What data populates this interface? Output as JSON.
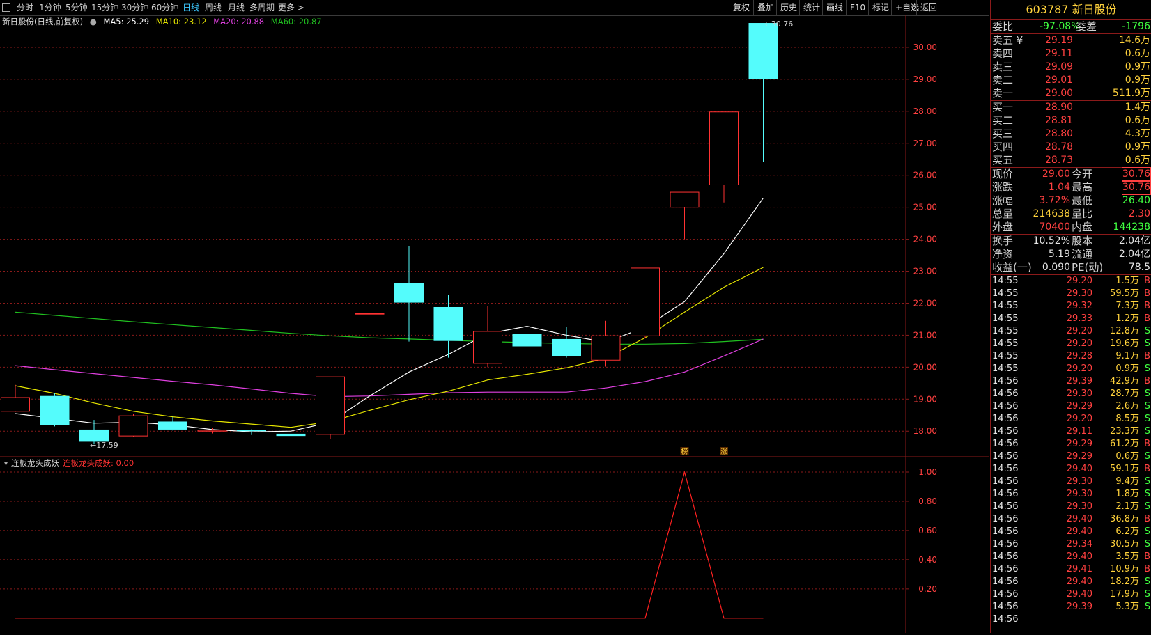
{
  "toolbar": {
    "periods": [
      "分时",
      "1分钟",
      "5分钟",
      "15分钟",
      "30分钟",
      "60分钟",
      "日线",
      "周线",
      "月线",
      "多周期",
      "更多 >"
    ],
    "active_period": "日线",
    "actions": [
      "复权",
      "叠加",
      "历史",
      "统计",
      "画线",
      "F10",
      "标记",
      "+自选",
      "返回"
    ]
  },
  "legend": {
    "name": "新日股份(日线,前复权)",
    "ma5": "MA5: 25.29",
    "ma10": "MA10: 23.12",
    "ma20": "MA20: 20.88",
    "ma60": "MA60: 20.87"
  },
  "indicator": {
    "name": "连板龙头成妖",
    "value_text": "连板龙头成妖: 0.00",
    "markers": [
      "榜",
      "涨"
    ]
  },
  "colors": {
    "up": "#ff3232",
    "down": "#54fcfc",
    "ma5": "#ffffff",
    "ma10": "#e6e600",
    "ma20": "#e040e0",
    "ma60": "#20c020",
    "grid": "#8b1a1a"
  },
  "chart_data": {
    "type": "candlestick",
    "y_axis": [
      30.0,
      29.0,
      28.0,
      27.0,
      26.0,
      25.0,
      24.0,
      23.0,
      22.0,
      21.0,
      20.0,
      19.0,
      18.0
    ],
    "ylim": [
      17.2,
      31.0
    ],
    "high_label": "30.76",
    "low_label": "17.59",
    "candles": [
      {
        "o": 18.62,
        "c": 19.05,
        "h": 19.45,
        "l": 18.6
      },
      {
        "o": 19.1,
        "c": 18.18,
        "h": 19.18,
        "l": 18.15
      },
      {
        "o": 18.05,
        "c": 17.67,
        "h": 18.35,
        "l": 17.59
      },
      {
        "o": 17.85,
        "c": 18.48,
        "h": 18.55,
        "l": 17.82
      },
      {
        "o": 18.3,
        "c": 18.05,
        "h": 18.45,
        "l": 18.02
      },
      {
        "o": 18.0,
        "c": 18.03,
        "h": 18.1,
        "l": 17.93
      },
      {
        "o": 18.04,
        "c": 18.0,
        "h": 18.06,
        "l": 17.88
      },
      {
        "o": 17.92,
        "c": 17.85,
        "h": 17.95,
        "l": 17.82
      },
      {
        "o": 17.9,
        "c": 19.7,
        "h": 19.7,
        "l": 17.75
      },
      {
        "o": 21.68,
        "c": 21.68,
        "h": 21.68,
        "l": 21.68
      },
      {
        "o": 22.63,
        "c": 22.02,
        "h": 23.78,
        "l": 20.8
      },
      {
        "o": 21.88,
        "c": 20.82,
        "h": 22.25,
        "l": 20.3
      },
      {
        "o": 20.12,
        "c": 21.12,
        "h": 21.92,
        "l": 20.0
      },
      {
        "o": 21.05,
        "c": 20.65,
        "h": 21.1,
        "l": 20.58
      },
      {
        "o": 20.88,
        "c": 20.35,
        "h": 21.25,
        "l": 20.3
      },
      {
        "o": 20.22,
        "c": 20.98,
        "h": 21.45,
        "l": 20.02
      },
      {
        "o": 20.98,
        "c": 23.1,
        "h": 23.1,
        "l": 20.9
      },
      {
        "o": 25.0,
        "c": 25.47,
        "h": 25.47,
        "l": 24.0
      },
      {
        "o": 25.7,
        "c": 27.98,
        "h": 27.98,
        "l": 25.15
      },
      {
        "o": 30.76,
        "c": 29.0,
        "h": 30.76,
        "l": 26.42
      }
    ],
    "ma5": [
      18.55,
      18.4,
      18.25,
      18.28,
      18.2,
      18.05,
      17.98,
      18.0,
      18.28,
      19.1,
      19.85,
      20.4,
      21.05,
      21.28,
      21.0,
      20.78,
      21.25,
      22.05,
      23.55,
      25.29
    ],
    "ma10": [
      19.42,
      19.18,
      18.88,
      18.62,
      18.45,
      18.32,
      18.22,
      18.12,
      18.3,
      18.65,
      18.98,
      19.25,
      19.6,
      19.78,
      19.98,
      20.28,
      20.92,
      21.72,
      22.5,
      23.12
    ],
    "ma20": [
      20.05,
      19.92,
      19.8,
      19.68,
      19.56,
      19.45,
      19.32,
      19.18,
      19.08,
      19.1,
      19.15,
      19.2,
      19.22,
      19.22,
      19.22,
      19.35,
      19.55,
      19.85,
      20.35,
      20.88
    ],
    "ma60": [
      21.72,
      21.62,
      21.52,
      21.42,
      21.33,
      21.24,
      21.15,
      21.06,
      20.98,
      20.92,
      20.88,
      20.84,
      20.8,
      20.77,
      20.74,
      20.72,
      20.72,
      20.74,
      20.8,
      20.87
    ],
    "indicator_axis": [
      1.0,
      0.8,
      0.6,
      0.4,
      0.2
    ],
    "indicator_values": [
      0,
      0,
      0,
      0,
      0,
      0,
      0,
      0,
      0,
      0,
      0,
      0,
      0,
      0,
      0,
      0,
      0,
      1.0,
      0,
      0
    ]
  },
  "quote": {
    "code_name": "603787 新日股份",
    "webi": {
      "label": "委比",
      "value": "-97.08%",
      "label2": "委差",
      "value2": "-1796"
    },
    "sells": [
      {
        "label": "卖五",
        "flag": "¥",
        "price": "29.19",
        "vol": "14.6万"
      },
      {
        "label": "卖四",
        "flag": "",
        "price": "29.11",
        "vol": "0.6万"
      },
      {
        "label": "卖三",
        "flag": "",
        "price": "29.09",
        "vol": "0.9万"
      },
      {
        "label": "卖二",
        "flag": "",
        "price": "29.01",
        "vol": "0.9万"
      },
      {
        "label": "卖一",
        "flag": "",
        "price": "29.00",
        "vol": "511.9万"
      }
    ],
    "buys": [
      {
        "label": "买一",
        "price": "28.90",
        "vol": "1.4万"
      },
      {
        "label": "买二",
        "price": "28.81",
        "vol": "0.6万"
      },
      {
        "label": "买三",
        "price": "28.80",
        "vol": "4.3万"
      },
      {
        "label": "买四",
        "price": "28.78",
        "vol": "0.9万"
      },
      {
        "label": "买五",
        "price": "28.73",
        "vol": "0.6万"
      }
    ],
    "stats": [
      {
        "l1": "现价",
        "v1": "29.00",
        "l2": "今开",
        "v2": "30.76"
      },
      {
        "l1": "涨跌",
        "v1": "1.04",
        "l2": "最高",
        "v2": "30.76"
      },
      {
        "l1": "涨幅",
        "v1": "3.72%",
        "l2": "最低",
        "v2": "26.40"
      },
      {
        "l1": "总量",
        "v1": "214638",
        "l2": "量比",
        "v2": "2.30"
      },
      {
        "l1": "外盘",
        "v1": "70400",
        "l2": "内盘",
        "v2": "144238"
      }
    ],
    "stats2": [
      {
        "l1": "换手",
        "v1": "10.52%",
        "l2": "股本",
        "v2": "2.04亿"
      },
      {
        "l1": "净资",
        "v1": "5.19",
        "l2": "流通",
        "v2": "2.04亿"
      },
      {
        "l1": "收益(一)",
        "v1": "0.090",
        "l2": "PE(动)",
        "v2": "78.5"
      }
    ]
  },
  "ticks": [
    {
      "t": "14:55",
      "p": "29.20",
      "v": "1.5万",
      "d": "B"
    },
    {
      "t": "14:55",
      "p": "29.30",
      "v": "59.5万",
      "d": "B"
    },
    {
      "t": "14:55",
      "p": "29.32",
      "v": "7.3万",
      "d": "B"
    },
    {
      "t": "14:55",
      "p": "29.33",
      "v": "1.2万",
      "d": "B"
    },
    {
      "t": "14:55",
      "p": "29.20",
      "v": "12.8万",
      "d": "S"
    },
    {
      "t": "14:55",
      "p": "29.20",
      "v": "19.6万",
      "d": "S"
    },
    {
      "t": "14:55",
      "p": "29.28",
      "v": "9.1万",
      "d": "B"
    },
    {
      "t": "14:55",
      "p": "29.20",
      "v": "0.9万",
      "d": "S"
    },
    {
      "t": "14:56",
      "p": "29.39",
      "v": "42.9万",
      "d": "B"
    },
    {
      "t": "14:56",
      "p": "29.30",
      "v": "28.7万",
      "d": "S"
    },
    {
      "t": "14:56",
      "p": "29.29",
      "v": "2.6万",
      "d": "S"
    },
    {
      "t": "14:56",
      "p": "29.20",
      "v": "8.5万",
      "d": "S"
    },
    {
      "t": "14:56",
      "p": "29.11",
      "v": "23.3万",
      "d": "S"
    },
    {
      "t": "14:56",
      "p": "29.29",
      "v": "61.2万",
      "d": "B"
    },
    {
      "t": "14:56",
      "p": "29.29",
      "v": "0.6万",
      "d": "S"
    },
    {
      "t": "14:56",
      "p": "29.40",
      "v": "59.1万",
      "d": "B"
    },
    {
      "t": "14:56",
      "p": "29.30",
      "v": "9.4万",
      "d": "S"
    },
    {
      "t": "14:56",
      "p": "29.30",
      "v": "1.8万",
      "d": "S"
    },
    {
      "t": "14:56",
      "p": "29.30",
      "v": "2.1万",
      "d": "S"
    },
    {
      "t": "14:56",
      "p": "29.40",
      "v": "36.8万",
      "d": "B"
    },
    {
      "t": "14:56",
      "p": "29.40",
      "v": "6.2万",
      "d": "S"
    },
    {
      "t": "14:56",
      "p": "29.34",
      "v": "30.5万",
      "d": "S"
    },
    {
      "t": "14:56",
      "p": "29.40",
      "v": "3.5万",
      "d": "B"
    },
    {
      "t": "14:56",
      "p": "29.41",
      "v": "10.9万",
      "d": "B"
    },
    {
      "t": "14:56",
      "p": "29.40",
      "v": "18.2万",
      "d": "S"
    },
    {
      "t": "14:56",
      "p": "29.40",
      "v": "17.9万",
      "d": "S"
    },
    {
      "t": "14:56",
      "p": "29.39",
      "v": "5.3万",
      "d": "S"
    },
    {
      "t": "14:56",
      "p": "",
      "v": "",
      "d": ""
    }
  ]
}
